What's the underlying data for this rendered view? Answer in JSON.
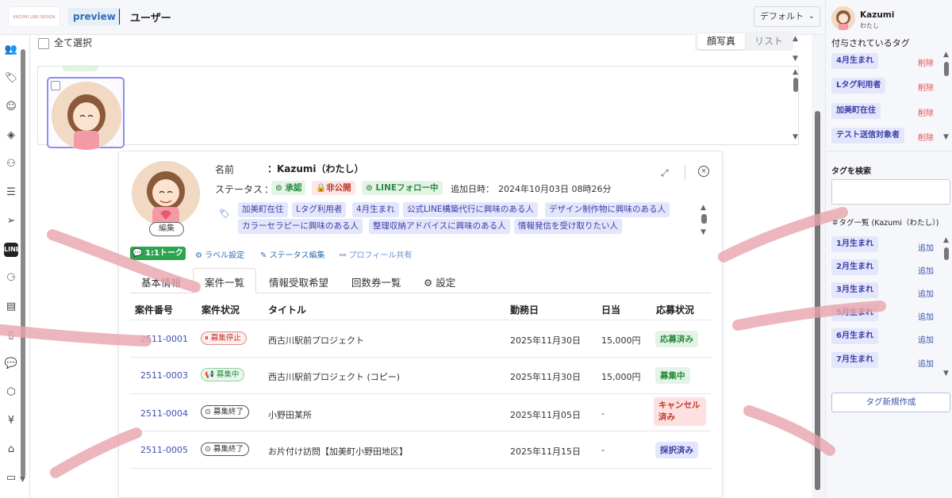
{
  "header": {
    "logo_text": "KAZUMI LINE DESIGN",
    "env_badge": "preview",
    "page_title": "ユーザー",
    "view_select": "デフォルト"
  },
  "toolbar": {
    "select_all_label": "全て選択",
    "view_modes": [
      "顔写真",
      "リスト"
    ],
    "active_view": "顔写真"
  },
  "sidebar_icons": [
    "users-icon",
    "tag-icon",
    "smile-icon",
    "ticket-icon",
    "user-settings-icon",
    "list-icon",
    "send-icon",
    "line-icon",
    "org-chart-icon",
    "document-icon",
    "file-icon",
    "chat-icon",
    "box-icon",
    "yen-icon",
    "building-icon",
    "calendar-icon"
  ],
  "profile": {
    "name_label": "名前",
    "name_value": "：Kazumi（わたし）",
    "status_label": "ステータス",
    "status_colon": "：",
    "statuses": [
      {
        "label": "承認",
        "kind": "ok"
      },
      {
        "label": "非公開",
        "kind": "ng"
      },
      {
        "label": "LINEフォロー中",
        "kind": "line"
      }
    ],
    "added_label": "追加日時：",
    "added_value": "2024年10月03日 08時26分",
    "edit_label": "編集",
    "tags": [
      "加美町在住",
      "Lタグ利用者",
      "4月生まれ",
      "公式LINE構築代行に興味のある人",
      "デザイン制作物に興味のある人",
      "カラーセラピーに興味のある人",
      "整理収納アドバイスに興味のある人",
      "情報発信を受け取りたい人"
    ],
    "actions": {
      "talk": "1:1トーク",
      "label_settings": "ラベル設定",
      "status_edit": "ステータス編集",
      "profile_share": "プロフィール共有"
    },
    "tabs": [
      "基本情報",
      "案件一覧",
      "情報受取希望",
      "回数券一覧",
      "設定"
    ],
    "active_tab": "案件一覧"
  },
  "table": {
    "headers": [
      "案件番号",
      "案件状況",
      "タイトル",
      "勤務日",
      "日当",
      "応募状況"
    ],
    "rows": [
      {
        "id": "2511-0001",
        "status": "募集停止",
        "status_kind": "stop",
        "title": "西古川駅前プロジェクト",
        "date": "2025年11月30日",
        "pay": "15,000円",
        "apply": "応募済み",
        "apply_kind": "applied"
      },
      {
        "id": "2511-0003",
        "status": "募集中",
        "status_kind": "open",
        "title": "西古川駅前プロジェクト (コピー)",
        "date": "2025年11月30日",
        "pay": "15,000円",
        "apply": "募集中",
        "apply_kind": "recruit"
      },
      {
        "id": "2511-0004",
        "status": "募集終了",
        "status_kind": "end",
        "title": "小野田某所",
        "date": "2025年11月05日",
        "pay": "-",
        "apply": "キャンセル済み",
        "apply_kind": "cancel"
      },
      {
        "id": "2511-0005",
        "status": "募集終了",
        "status_kind": "end",
        "title": "お片付け訪問【加美町小野田地区】",
        "date": "2025年11月15日",
        "pay": "-",
        "apply": "採択済み",
        "apply_kind": "adopt"
      }
    ]
  },
  "right_panel": {
    "user_name": "Kazumi",
    "user_sub": "わたし",
    "assigned_title": "付与されているタグ",
    "assigned_tags": [
      "4月生まれ",
      "Lタグ利用者",
      "加美町在住",
      "テスト送信対象者"
    ],
    "delete_label": "削除",
    "search_title": "タグを検索",
    "search_placeholder": "",
    "list_title": "＃タグ一覧",
    "list_title_sub": "(Kazumi（わたし）)",
    "list_tags": [
      "1月生まれ",
      "2月生まれ",
      "3月生まれ",
      "5月生まれ",
      "6月生まれ",
      "7月生まれ"
    ],
    "add_label": "追加",
    "new_tag_button": "タグ新規作成"
  },
  "colors": {
    "accent": "#3a53b0",
    "tag_bg": "#e4e6fb",
    "success": "#2a8b3d",
    "danger": "#c0392b",
    "line_green": "#2ea44f"
  }
}
